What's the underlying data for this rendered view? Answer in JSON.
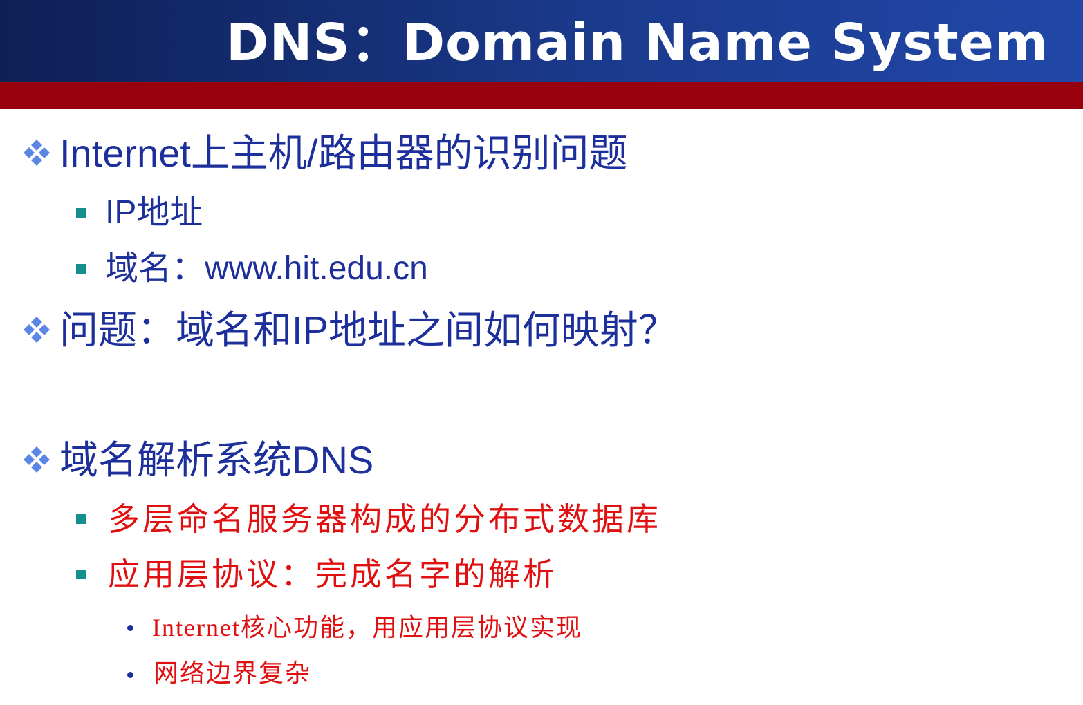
{
  "title": "DNS：Domain Name System",
  "colors": {
    "title_bar": "#1a3a8c",
    "accent_bar": "#98000e",
    "body_text": "#1c2f9a",
    "highlight_text": "#e01010",
    "square_bullet": "#13908d",
    "diamond_bullet": "#5b86e5"
  },
  "bullets": [
    {
      "text": "Internet上主机/路由器的识别问题",
      "icon": "diamond-bullet-icon",
      "children": [
        {
          "text": "IP地址",
          "icon": "square-bullet-icon"
        },
        {
          "text": "域名：www.hit.edu.cn",
          "icon": "square-bullet-icon"
        }
      ]
    },
    {
      "text": "问题：域名和IP地址之间如何映射？",
      "icon": "diamond-bullet-icon",
      "children": []
    },
    {
      "text": "域名解析系统DNS",
      "icon": "diamond-bullet-icon",
      "children": [
        {
          "text": "多层命名服务器构成的分布式数据库",
          "icon": "square-bullet-icon"
        },
        {
          "text": "应用层协议：完成名字的解析",
          "icon": "square-bullet-icon",
          "children": [
            {
              "text": "Internet核心功能，用应用层协议实现",
              "icon": "dot-bullet-icon"
            },
            {
              "text": "网络边界复杂",
              "icon": "dot-bullet-icon"
            }
          ]
        }
      ]
    }
  ]
}
